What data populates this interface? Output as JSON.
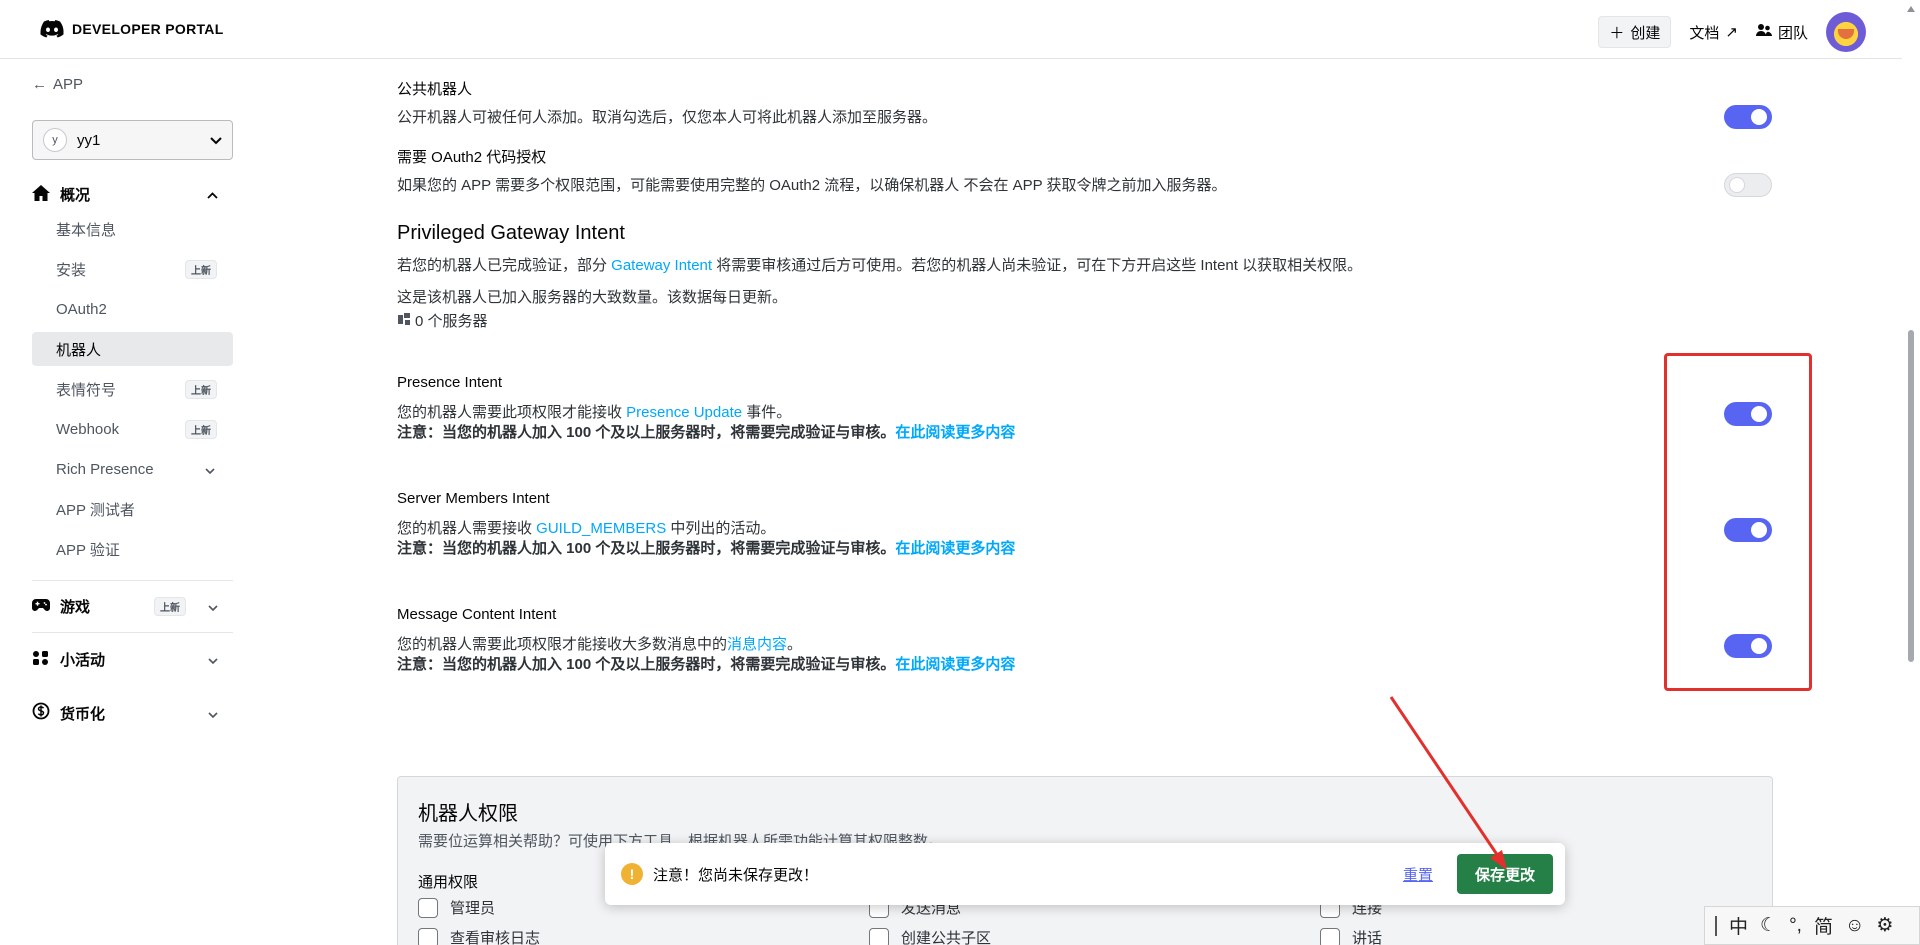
{
  "topbar": {
    "logo_text": "DEVELOPER PORTAL",
    "create_label": "创建",
    "docs_label": "文档",
    "team_label": "团队"
  },
  "sidebar": {
    "back_label": "APP",
    "app_select": {
      "avatar_letter": "y",
      "value": "yy1"
    },
    "overview": {
      "label": "概况",
      "items": [
        {
          "label": "基本信息"
        },
        {
          "label": "安装",
          "badge": "上新"
        },
        {
          "label": "OAuth2"
        },
        {
          "label": "机器人"
        },
        {
          "label": "表情符号",
          "badge": "上新"
        },
        {
          "label": "Webhook",
          "badge": "上新"
        },
        {
          "label": "Rich Presence"
        },
        {
          "label": "APP 测试者"
        },
        {
          "label": "APP 验证"
        }
      ]
    },
    "games": {
      "label": "游戏",
      "badge": "上新"
    },
    "activities": {
      "label": "小活动"
    },
    "monetization": {
      "label": "货币化"
    }
  },
  "main": {
    "public_bot": {
      "title": "公共机器人",
      "desc": "公开机器人可被任何人添加。取消勾选后，仅您本人可将此机器人添加至服务器。",
      "enabled": true
    },
    "oauth2_grant": {
      "title": "需要 OAuth2 代码授权",
      "desc": "如果您的 APP 需要多个权限范围，可能需要使用完整的 OAuth2 流程，以确保机器人 不会在 APP 获取令牌之前加入服务器。",
      "enabled": false
    },
    "privileged": {
      "heading": "Privileged Gateway Intent",
      "desc_pre": "若您的机器人已完成验证，部分 ",
      "desc_link": "Gateway Intent",
      "desc_post": " 将需要审核通过后方可使用。若您的机器人尚未验证，可在下方开启这些 Intent 以获取相关权限。",
      "server_note": "这是该机器人已加入服务器的大致数量。该数据每日更新。",
      "server_count": "0 个服务器"
    },
    "intents": [
      {
        "title": "Presence Intent",
        "desc_pre": "您的机器人需要此项权限才能接收 ",
        "desc_link": "Presence Update",
        "desc_post": " 事件。",
        "note": "注意：当您的机器人加入 100 个及以上服务器时，将需要完成验证与审核。",
        "note_link": "在此阅读更多内容",
        "enabled": true
      },
      {
        "title": "Server Members Intent",
        "desc_pre": "您的机器人需要接收 ",
        "desc_link": "GUILD_MEMBERS",
        "desc_post": " 中列出的活动。",
        "note": "注意：当您的机器人加入 100 个及以上服务器时，将需要完成验证与审核。",
        "note_link": "在此阅读更多内容",
        "enabled": true
      },
      {
        "title": "Message Content Intent",
        "desc_pre": "您的机器人需要此项权限才能接收大多数消息中的",
        "desc_link": "消息内容",
        "desc_post": "。",
        "note": "注意：当您的机器人加入 100 个及以上服务器时，将需要完成验证与审核。",
        "note_link": "在此阅读更多内容",
        "enabled": true
      }
    ],
    "permissions": {
      "title": "机器人权限",
      "desc": "需要位运算相关帮助？可使用下方工具，根据机器人所需功能计算其权限整数。",
      "general_label": "通用权限",
      "items": [
        "管理员",
        "发送消息",
        "连接",
        "查看审核日志",
        "创建公共子区",
        "讲话"
      ]
    }
  },
  "unsaved_bar": {
    "message": "注意！您尚未保存更改！",
    "reset_label": "重置",
    "save_label": "保存更改"
  },
  "ime": {
    "mode": "中",
    "punct": "°,",
    "script": "简"
  },
  "colors": {
    "accent": "#5865f2",
    "link": "#00a8fc",
    "save": "#248046",
    "highlight": "#e2302c"
  }
}
